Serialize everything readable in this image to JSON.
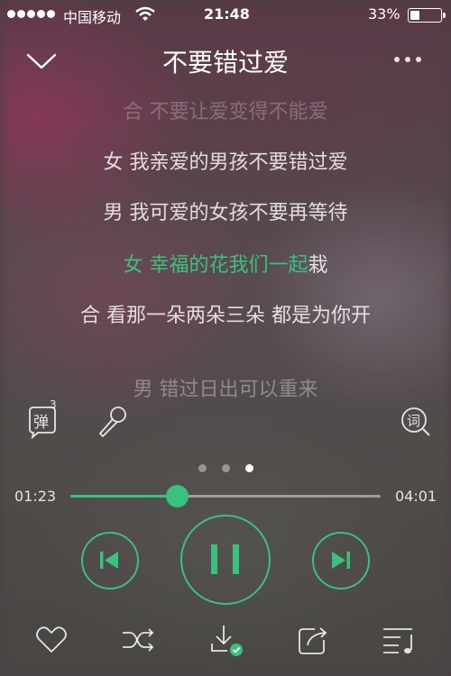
{
  "status_bar": {
    "carrier": "中国移动",
    "time": "21:48",
    "battery_percent_text": "33%",
    "battery_level": 0.33,
    "icons": [
      "signal-dots-icon",
      "wifi-icon",
      "battery-icon"
    ]
  },
  "header": {
    "title": "不要错过爱",
    "back_icon": "chevron-down-icon",
    "more_icon": "more-dots-icon"
  },
  "lyrics": [
    {
      "text": "合 不要让爱变得不能爱",
      "state": "faded"
    },
    {
      "text": "女 我亲爱的男孩不要错过爱",
      "state": "normal"
    },
    {
      "text": "男 我可爱的女孩不要再等待",
      "state": "normal"
    },
    {
      "sung": "女 幸福的花我们一起",
      "unsung": "栽",
      "state": "active"
    },
    {
      "text": "合 看那一朵两朵三朵 都是为你开",
      "state": "normal"
    },
    {
      "text": "男 错过日出可以重来",
      "state": "dim"
    }
  ],
  "tools": {
    "danmaku_label": "弹",
    "danmaku_count": "3",
    "lyrics_label": "词",
    "icons": [
      "danmaku-icon",
      "microphone-icon",
      "lyrics-search-icon"
    ]
  },
  "page_indicator": {
    "count": 3,
    "active_index": 2
  },
  "progress": {
    "elapsed": "01:23",
    "total": "04:01",
    "fraction": 0.344
  },
  "controls": {
    "icons": [
      "previous-icon",
      "pause-icon",
      "next-icon"
    ]
  },
  "bottom_bar": {
    "icons": [
      "heart-icon",
      "shuffle-icon",
      "download-icon",
      "share-icon",
      "playlist-icon"
    ]
  },
  "colors": {
    "accent": "#39c17d",
    "text": "#ffffff"
  }
}
